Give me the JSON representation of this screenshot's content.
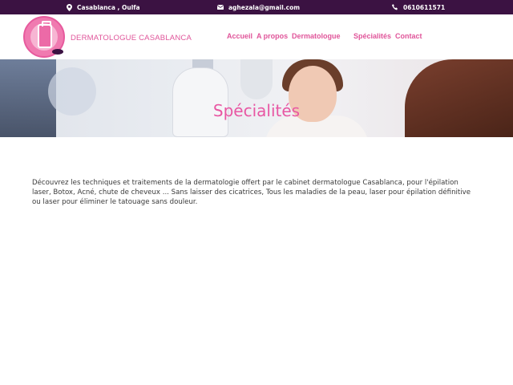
{
  "topbar": {
    "location": "Casablanca , Oulfa",
    "email": "aghezala@gmail.com",
    "phone": "0610611571",
    "icons": [
      "map-pin-icon",
      "envelope-icon",
      "phone-icon"
    ],
    "background": "#3b1242"
  },
  "header": {
    "brand": "DERMATOLOGUE CASABLANCA",
    "nav": [
      "Accueil",
      "A propos",
      "Dermatologue",
      "Spécialités",
      "Contact"
    ],
    "accent": "#e0559a"
  },
  "hero": {
    "title": "Spécialités"
  },
  "main": {
    "intro": "Découvrez les techniques et traitements de la dermatologie offert par le cabinet dermatologue Casablanca, pour l'épilation laser, Botox, Acné, chute de cheveux ... Sans laisser des cicatrices,  Tous les maladies de la peau, laser pour épilation définitive ou laser pour éliminer le tatouage sans douleur."
  }
}
